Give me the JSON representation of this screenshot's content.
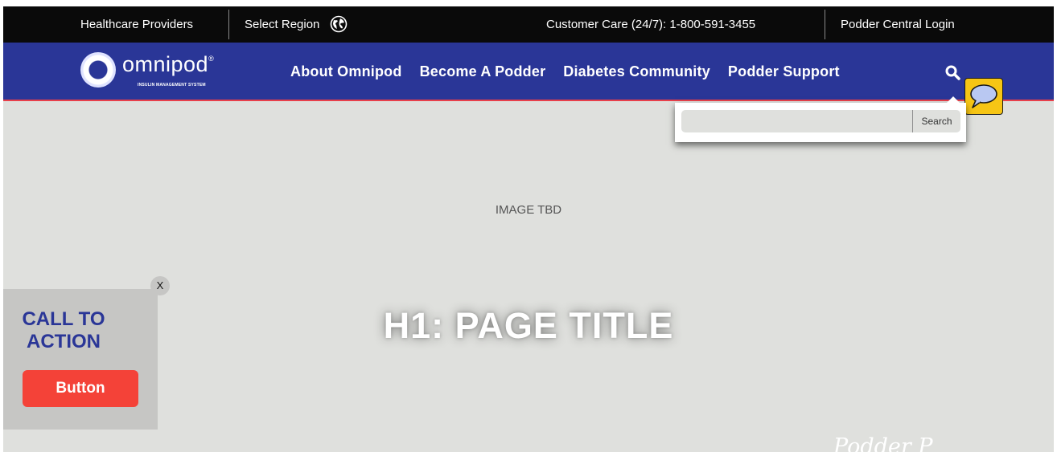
{
  "utility_bar": {
    "healthcare_providers": "Healthcare Providers",
    "select_region": "Select Region",
    "customer_care": "Customer Care (24/7):",
    "phone": "1-800-591-3455",
    "login": "Podder Central Login"
  },
  "logo": {
    "word": "omnipod",
    "tagline": "INSULIN MANAGEMENT SYSTEM"
  },
  "nav": {
    "items": [
      {
        "label": "About Omnipod"
      },
      {
        "label": "Become A Podder"
      },
      {
        "label": "Diabetes Community"
      },
      {
        "label": "Podder Support"
      }
    ]
  },
  "search": {
    "value": "",
    "button_label": "Search"
  },
  "hero": {
    "placeholder": "IMAGE TBD",
    "title": "H1: PAGE TITLE"
  },
  "cta": {
    "close_label": "X",
    "heading_line1": "CALL TO",
    "heading_line2": "ACTION",
    "button_label": "Button"
  },
  "footer_brand": "Podder P",
  "colors": {
    "utility_bg": "#0a0a0a",
    "nav_bg": "#2a3697",
    "nav_border": "#e8404a",
    "hero_bg": "#dfe0dd",
    "cta_bg": "#c6c6c4",
    "cta_button": "#f44238",
    "chat_bg": "#f6c515"
  },
  "icons": [
    "globe-icon",
    "search-icon",
    "chat-bubble-icon",
    "close-icon"
  ]
}
